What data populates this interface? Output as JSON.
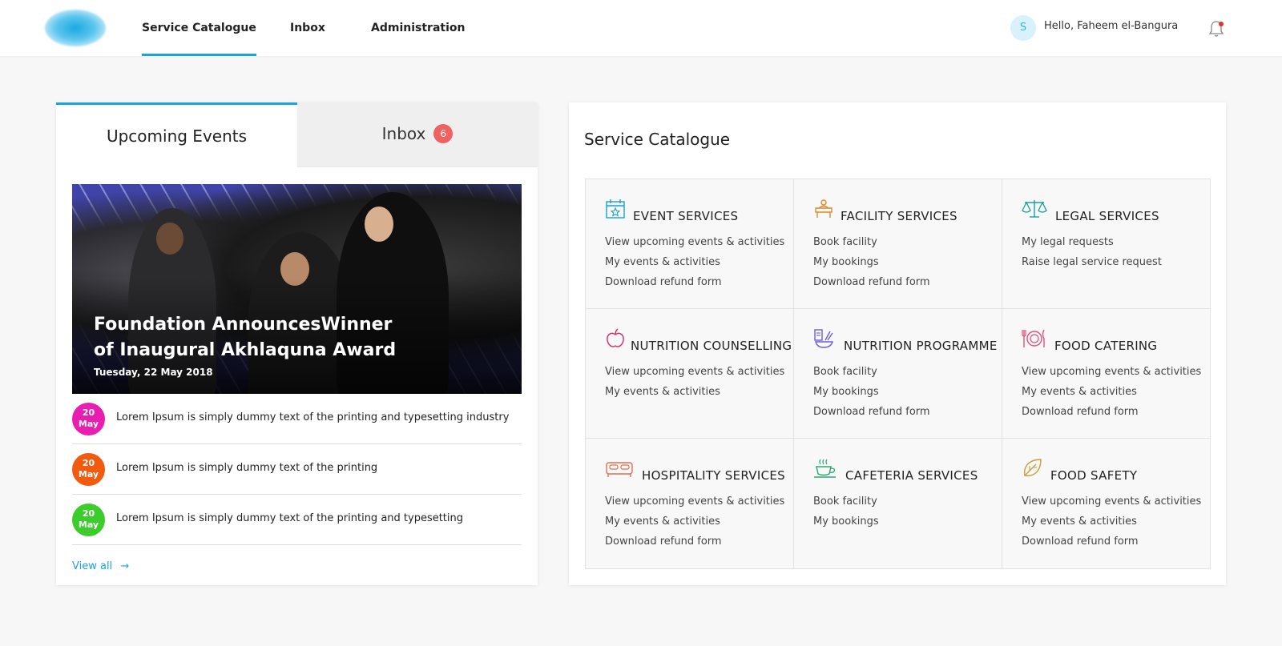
{
  "nav": {
    "items": [
      {
        "label": "Service Catalogue"
      },
      {
        "label": "Inbox"
      },
      {
        "label": "Administration"
      }
    ],
    "user_initial": "S",
    "greeting": "Hello, Faheem el-Bangura"
  },
  "left": {
    "tabs": [
      {
        "label": "Upcoming Events"
      },
      {
        "label": "Inbox",
        "badge": "6"
      }
    ],
    "hero": {
      "title_line1": "Foundation AnnouncesWinner",
      "title_line2": "of Inaugural Akhlaquna Award",
      "date": "Tuesday, 22 May 2018"
    },
    "events": [
      {
        "day": "20",
        "month": "May",
        "color": "#e91eb0",
        "text": "Lorem Ipsum is simply dummy text of the printing and typesetting industry"
      },
      {
        "day": "20",
        "month": "May",
        "color": "#f15a0f",
        "text": "Lorem Ipsum is simply dummy text of the printing"
      },
      {
        "day": "20",
        "month": "May",
        "color": "#3ccc2c",
        "text": "Lorem Ipsum is simply dummy text of the printing and typesetting"
      }
    ],
    "view_all": "View all"
  },
  "catalogue": {
    "title": "Service Catalogue",
    "cells": [
      {
        "title": "EVENT SERVICES",
        "icon": "calendar-icon",
        "color": "#1a9fd8",
        "links": [
          "View upcoming events & activities",
          "My events & activities",
          "Download refund form"
        ]
      },
      {
        "title": "FACILITY SERVICES",
        "icon": "facility-icon",
        "color": "#e08a2a",
        "links": [
          "Book facility",
          "My bookings",
          "Download refund form"
        ]
      },
      {
        "title": "LEGAL SERVICES",
        "icon": "scales-icon",
        "color": "#1a9fa0",
        "links": [
          "My legal requests",
          "Raise legal service request"
        ]
      },
      {
        "title": "NUTRITION COUNSELLING",
        "icon": "apple-icon",
        "color": "#d62b6a",
        "links": [
          "View upcoming events & activities",
          "My events & activities"
        ]
      },
      {
        "title": "NUTRITION PROGRAMME",
        "icon": "meal-icon",
        "color": "#6a5ed8",
        "links": [
          "Book facility",
          "My bookings",
          "Download refund form"
        ]
      },
      {
        "title": "FOOD CATERING",
        "icon": "plate-icon",
        "color": "#e0507a",
        "links": [
          "View upcoming events & activities",
          "My events & activities",
          "Download refund form"
        ]
      },
      {
        "title": "HOSPITALITY SERVICES",
        "icon": "bed-icon",
        "color": "#e07050",
        "links": [
          "View upcoming events & activities",
          "My events & activities",
          "Download refund form"
        ]
      },
      {
        "title": "CAFETERIA SERVICES",
        "icon": "coffee-icon",
        "color": "#2aa86a",
        "links": [
          "Book facility",
          "My bookings"
        ]
      },
      {
        "title": "FOOD SAFETY",
        "icon": "leaf-icon",
        "color": "#c8a040",
        "links": [
          "View upcoming events & activities",
          "My events & activities",
          "Download refund form"
        ]
      }
    ]
  }
}
